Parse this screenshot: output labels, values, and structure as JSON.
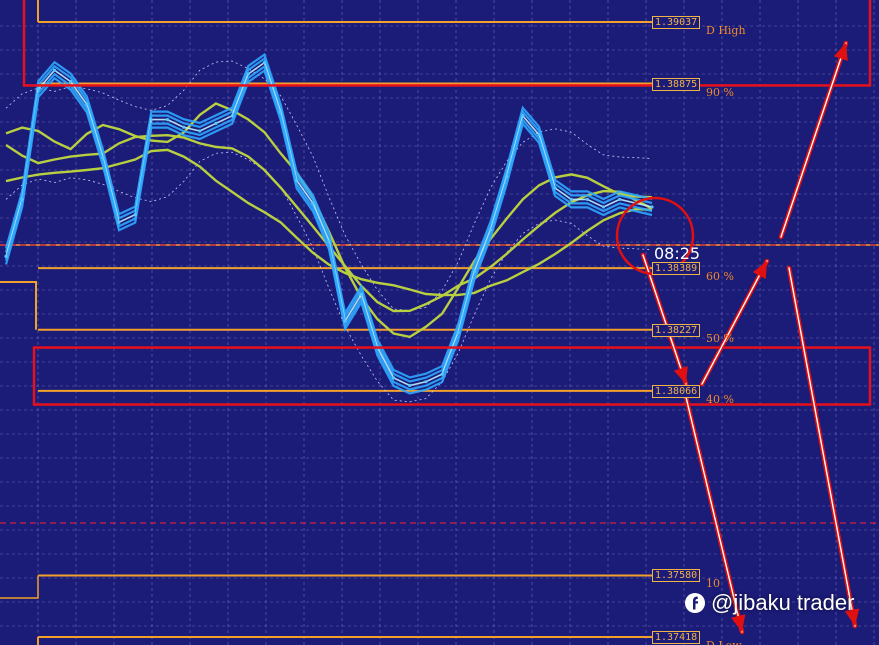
{
  "chart_data": {
    "type": "line",
    "title": "",
    "instrument_note": "",
    "price_levels": [
      {
        "price": "1.39037",
        "label": "D High"
      },
      {
        "price": "1.38875",
        "label": "90 %"
      },
      {
        "price": "1.38389",
        "label": "60 %"
      },
      {
        "price": "1.38227",
        "label": "50 %"
      },
      {
        "price": "1.38066",
        "label": "40 %"
      },
      {
        "price": "1.37580",
        "label": "10"
      },
      {
        "price": "1.37418",
        "label": "D Low"
      }
    ],
    "ylim": [
      1.3735,
      1.3912
    ],
    "current_price": 1.3845,
    "series": [
      {
        "name": "",
        "x": [
          0,
          1,
          2,
          3,
          4,
          5,
          6,
          7,
          8,
          9,
          10,
          11,
          12,
          13,
          14,
          15,
          16,
          17,
          18,
          19,
          20,
          21,
          22,
          23,
          24,
          25,
          26,
          27,
          28,
          29,
          30,
          31,
          32,
          33,
          34,
          35,
          36,
          37,
          38,
          39,
          40
        ],
        "values": [
          1.3842,
          1.3857,
          1.3886,
          1.3891,
          1.3888,
          1.3882,
          1.3868,
          1.3851,
          1.3853,
          1.3878,
          1.3878,
          1.3876,
          1.3875,
          1.3877,
          1.3879,
          1.389,
          1.3893,
          1.388,
          1.3862,
          1.3856,
          1.3846,
          1.3825,
          1.3832,
          1.3818,
          1.381,
          1.3808,
          1.3809,
          1.3811,
          1.3822,
          1.3838,
          1.3849,
          1.3863,
          1.3879,
          1.3874,
          1.386,
          1.3857,
          1.3857,
          1.3855,
          1.3857,
          1.3856,
          1.3855
        ]
      }
    ],
    "colors": {
      "background": "#1b1b78",
      "price_line": "#57c8ff",
      "price_band": "#2fa8ff",
      "moving_average": "#b8d040",
      "level_line": "#f2a02b",
      "zone_box": "#e8101c",
      "projection_arrow": "#e01010"
    },
    "zones": [
      {
        "label": "resistance zone",
        "price_top": 1.391,
        "price_bottom": 1.3887
      },
      {
        "label": "support zone",
        "price_top": 1.3818,
        "price_bottom": 1.3803
      }
    ],
    "countdown": "08:25"
  },
  "watermark": {
    "text": "@jibaku trader",
    "icon": "brand-logo-icon"
  }
}
